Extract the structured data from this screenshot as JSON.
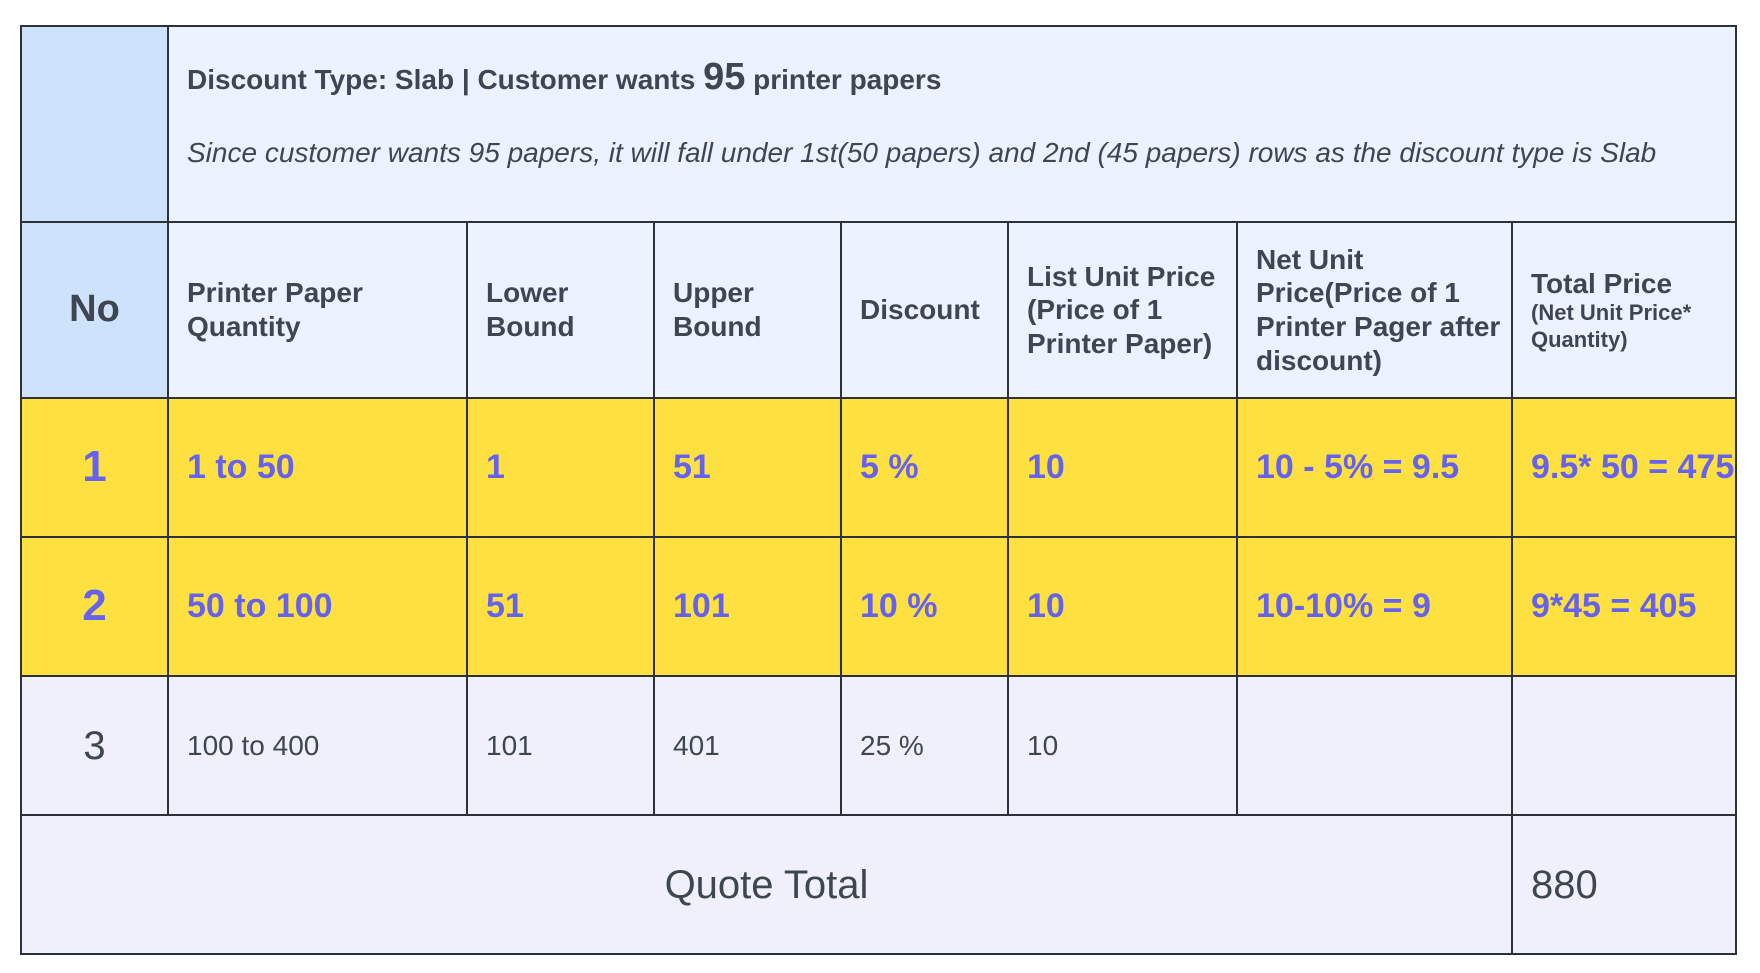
{
  "info": {
    "title_prefix": "Discount Type: Slab | Customer wants ",
    "title_quantity": "95",
    "title_suffix": " printer papers",
    "note": "Since customer wants 95 papers, it will fall under 1st(50 papers) and 2nd (45 papers) rows as the discount type is Slab"
  },
  "headers": {
    "no": "No",
    "quantity": "Printer Paper Quantity",
    "lower_bound": "Lower Bound",
    "upper_bound": "Upper Bound",
    "discount": "Discount",
    "list_unit_price": "List Unit Price (Price of 1 Printer Paper)",
    "net_unit_price": "Net Unit Price(Price of 1 Printer Pager after discount)",
    "total_price": "Total Price",
    "total_price_sub": "(Net Unit Price* Quantity)"
  },
  "rows": [
    {
      "no": "1",
      "quantity": "1 to 50",
      "lower_bound": "1",
      "upper_bound": "51",
      "discount": "5 %",
      "list_unit_price": "10",
      "net_unit_price": "10 - 5% = 9.5",
      "total_price": "9.5* 50 = 475",
      "highlighted": true
    },
    {
      "no": "2",
      "quantity": "50 to 100",
      "lower_bound": "51",
      "upper_bound": "101",
      "discount": "10 %",
      "list_unit_price": "10",
      "net_unit_price": "10-10% = 9",
      "total_price": "9*45  = 405",
      "highlighted": true
    },
    {
      "no": "3",
      "quantity": "100 to 400",
      "lower_bound": "101",
      "upper_bound": "401",
      "discount": "25 %",
      "list_unit_price": "10",
      "net_unit_price": "",
      "total_price": "",
      "highlighted": false
    }
  ],
  "footer": {
    "label": "Quote Total",
    "value": "880"
  },
  "colors": {
    "border": "#2d3138",
    "no_column": "#cfe2fc",
    "header_bg": "#ecf3fe",
    "highlight_bg": "#fee140",
    "highlight_text": "#6562ee",
    "plain_bg": "#eff0fb",
    "text": "#3d4651"
  }
}
